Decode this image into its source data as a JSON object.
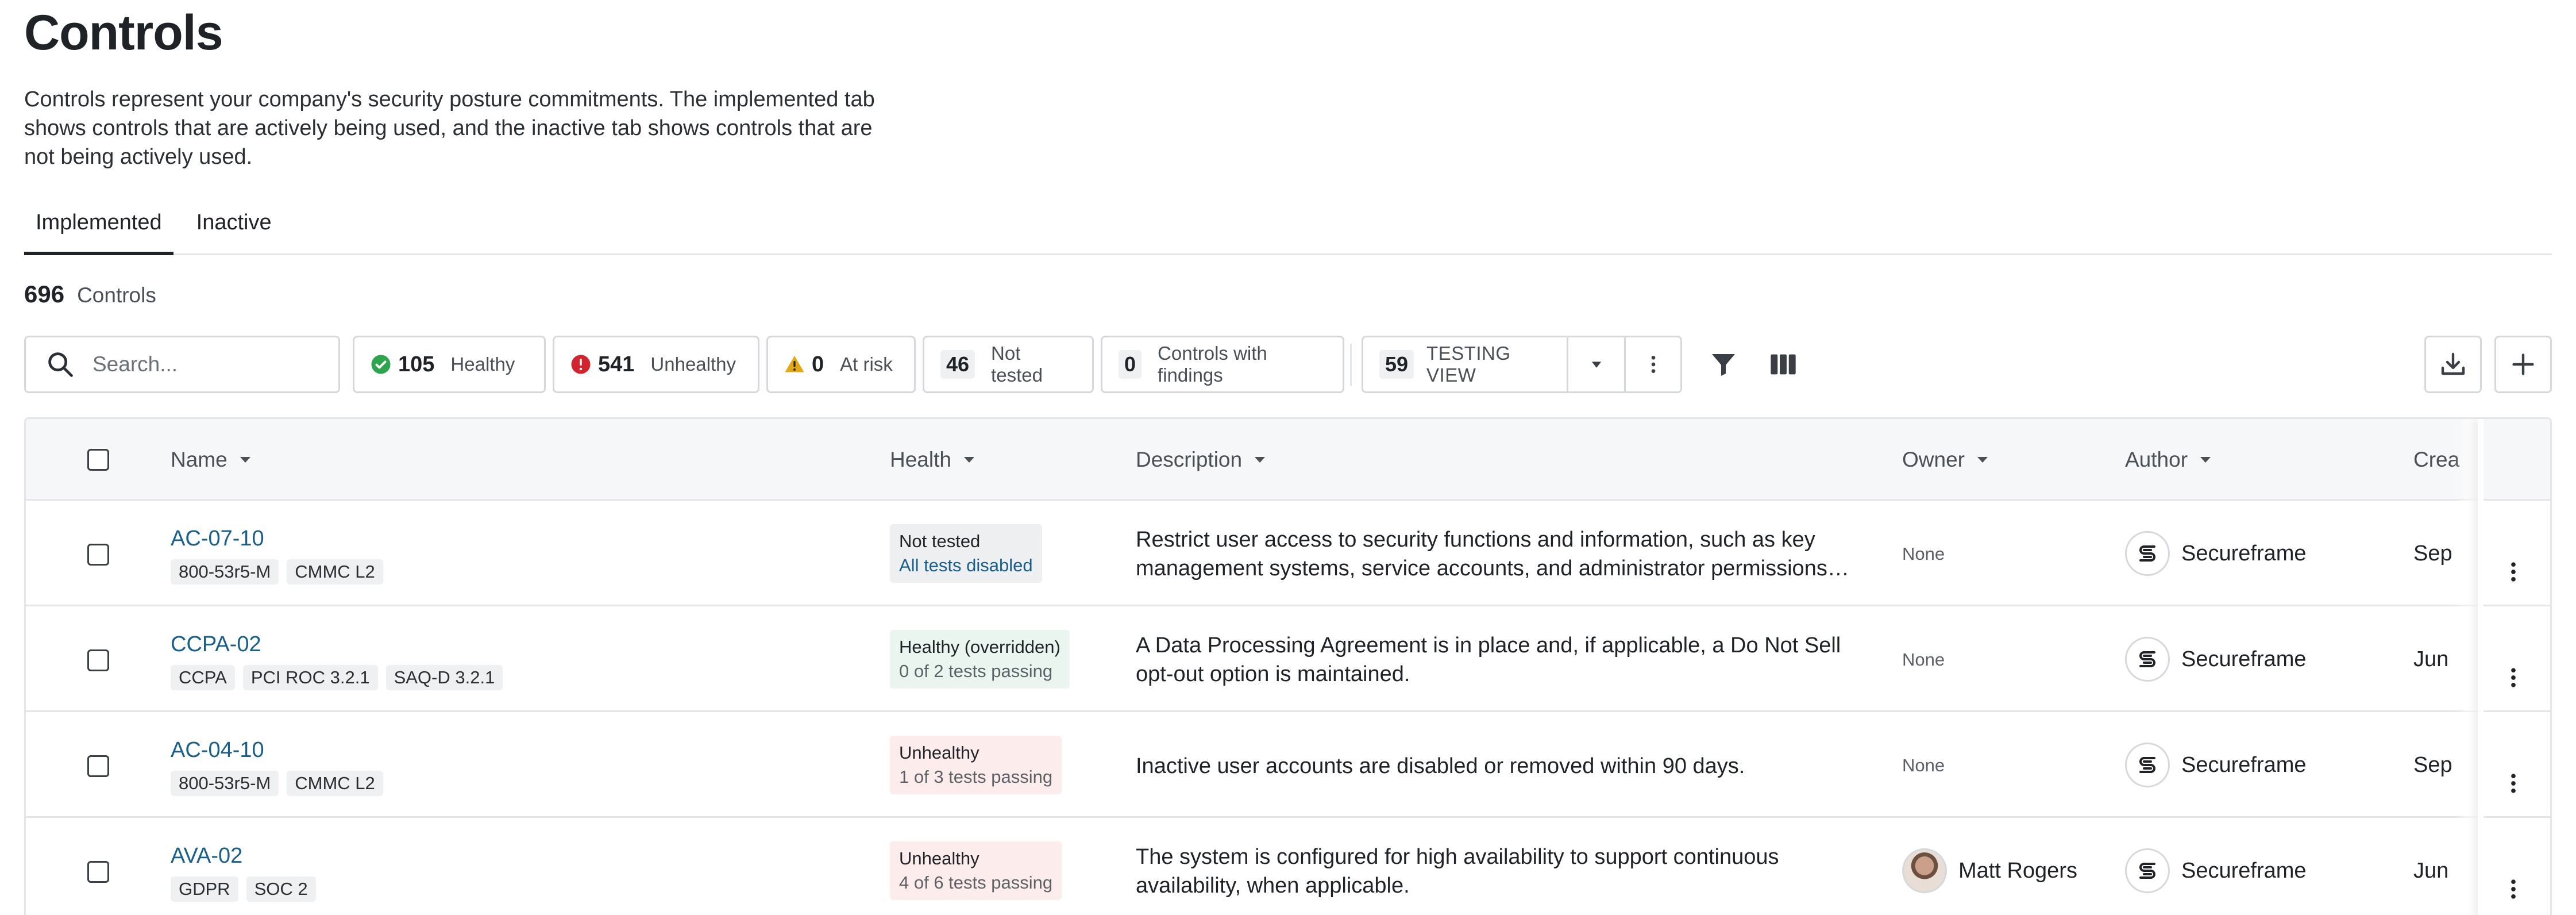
{
  "page": {
    "title": "Controls",
    "intro": "Controls represent your company's security posture commitments. The implemented tab shows controls that are actively being used, and the inactive tab shows controls that are not being actively used."
  },
  "tabs": [
    {
      "label": "Implemented",
      "active": true
    },
    {
      "label": "Inactive",
      "active": false
    }
  ],
  "summary": {
    "count": "696",
    "label": "Controls"
  },
  "toolbar": {
    "search_placeholder": "Search...",
    "healthy": {
      "count": "105",
      "label": "Healthy",
      "icon": "check-circle-icon",
      "color": "#2ea44f"
    },
    "unhealthy": {
      "count": "541",
      "label": "Unhealthy",
      "icon": "error-circle-icon",
      "color": "#d1242f"
    },
    "at_risk": {
      "count": "0",
      "label": "At risk",
      "icon": "warning-triangle-icon",
      "color": "#d4a017"
    },
    "not_tested": {
      "count": "46",
      "label": "Not tested"
    },
    "findings": {
      "count": "0",
      "label": "Controls with findings"
    },
    "view": {
      "count": "59",
      "label": "TESTING VIEW"
    },
    "icons": [
      "chevron-down-icon",
      "more-vertical-icon",
      "filter-icon",
      "columns-icon",
      "download-icon",
      "plus-icon"
    ]
  },
  "table": {
    "columns": [
      "Name",
      "Health",
      "Description",
      "Owner",
      "Author",
      "Crea"
    ],
    "rows": [
      {
        "id": "AC-07-10",
        "tags": [
          "800-53r5-M",
          "CMMC L2"
        ],
        "health_status": "Not tested",
        "health_detail": "All tests disabled",
        "health_tone": "gray",
        "description": "Restrict user access to security functions and information, such as key management systems, service accounts, and administrator permissions in...",
        "owner": "None",
        "author": "Secureframe",
        "created": "Sep"
      },
      {
        "id": "CCPA-02",
        "tags": [
          "CCPA",
          "PCI ROC 3.2.1",
          "SAQ-D 3.2.1"
        ],
        "health_status": "Healthy (overridden)",
        "health_detail": "0 of 2 tests passing",
        "health_tone": "green",
        "description": "A Data Processing Agreement is in place and, if applicable, a Do Not Sell opt-out option is maintained.",
        "owner": "None",
        "author": "Secureframe",
        "created": "Jun"
      },
      {
        "id": "AC-04-10",
        "tags": [
          "800-53r5-M",
          "CMMC L2"
        ],
        "health_status": "Unhealthy",
        "health_detail": "1 of 3 tests passing",
        "health_tone": "red",
        "description": "Inactive user accounts are disabled or removed within 90 days.",
        "owner": "None",
        "author": "Secureframe",
        "created": "Sep"
      },
      {
        "id": "AVA-02",
        "tags": [
          "GDPR",
          "SOC 2"
        ],
        "health_status": "Unhealthy",
        "health_detail": "4 of 6 tests passing",
        "health_tone": "red",
        "description": "The system is configured for high availability to support continuous availability, when applicable.",
        "owner": "Matt Rogers",
        "author": "Secureframe",
        "created": "Jun"
      }
    ]
  }
}
